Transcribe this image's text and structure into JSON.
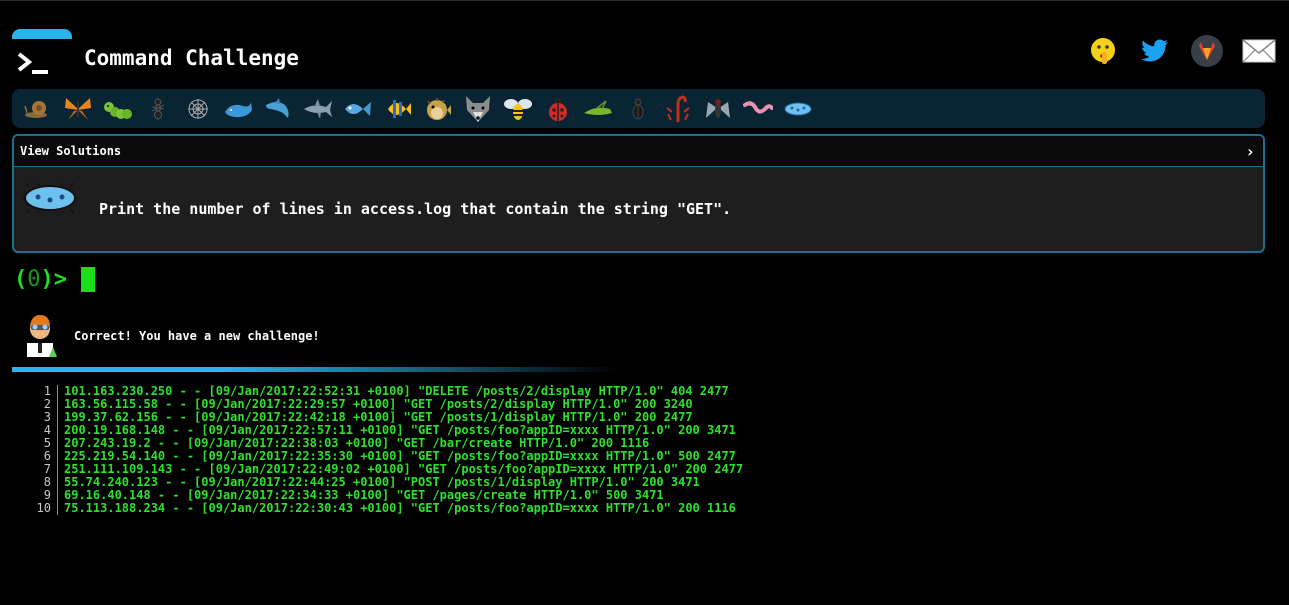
{
  "header": {
    "title": "Command Challenge",
    "logo_icon": "terminal-prompt-icon",
    "social": [
      {
        "name": "shushing-face-icon",
        "label": "emoji"
      },
      {
        "name": "twitter-icon",
        "label": "Twitter"
      },
      {
        "name": "gitlab-icon",
        "label": "GitLab"
      },
      {
        "name": "mail-icon",
        "label": "Email"
      }
    ]
  },
  "levels": [
    {
      "icon": "snail-icon"
    },
    {
      "icon": "butterfly-icon"
    },
    {
      "icon": "caterpillar-icon"
    },
    {
      "icon": "ant-icon"
    },
    {
      "icon": "spider-web-icon"
    },
    {
      "icon": "whale-icon"
    },
    {
      "icon": "dolphin-icon"
    },
    {
      "icon": "shark-icon"
    },
    {
      "icon": "fish-icon"
    },
    {
      "icon": "tropical-fish-icon"
    },
    {
      "icon": "blowfish-icon"
    },
    {
      "icon": "wolf-icon"
    },
    {
      "icon": "bee-icon"
    },
    {
      "icon": "ladybug-icon"
    },
    {
      "icon": "cricket-icon"
    },
    {
      "icon": "beetle-icon"
    },
    {
      "icon": "scorpion-icon"
    },
    {
      "icon": "fly-icon"
    },
    {
      "icon": "worm-icon"
    },
    {
      "icon": "microbe-icon"
    }
  ],
  "challenge": {
    "view_solutions": "View Solutions",
    "chevron": "›",
    "description": "Print the number of lines in access.log that contain the string \"GET\"."
  },
  "prompt": {
    "open": "(",
    "count": "0",
    "close": ")>"
  },
  "message": {
    "text": "Correct! You have a new challenge!"
  },
  "log": [
    {
      "n": "1",
      "text": "101.163.230.250 - - [09/Jan/2017:22:52:31 +0100] \"DELETE /posts/2/display HTTP/1.0\" 404 2477"
    },
    {
      "n": "2",
      "text": "163.56.115.58 - - [09/Jan/2017:22:29:57 +0100] \"GET /posts/2/display HTTP/1.0\" 200 3240"
    },
    {
      "n": "3",
      "text": "199.37.62.156 - - [09/Jan/2017:22:42:18 +0100] \"GET /posts/1/display HTTP/1.0\" 200 2477"
    },
    {
      "n": "4",
      "text": "200.19.168.148 - - [09/Jan/2017:22:57:11 +0100] \"GET /posts/foo?appID=xxxx HTTP/1.0\" 200 3471"
    },
    {
      "n": "5",
      "text": "207.243.19.2 - - [09/Jan/2017:22:38:03 +0100] \"GET /bar/create HTTP/1.0\" 200 1116"
    },
    {
      "n": "6",
      "text": "225.219.54.140 - - [09/Jan/2017:22:35:30 +0100] \"GET /posts/foo?appID=xxxx HTTP/1.0\" 500 2477"
    },
    {
      "n": "7",
      "text": "251.111.109.143 - - [09/Jan/2017:22:49:02 +0100] \"GET /posts/foo?appID=xxxx HTTP/1.0\" 200 2477"
    },
    {
      "n": "8",
      "text": "55.74.240.123 - - [09/Jan/2017:22:44:25 +0100] \"POST /posts/1/display HTTP/1.0\" 200 3471"
    },
    {
      "n": "9",
      "text": "69.16.40.148 - - [09/Jan/2017:22:34:33 +0100] \"GET /pages/create HTTP/1.0\" 500 3471"
    },
    {
      "n": "10",
      "text": "75.113.188.234 - - [09/Jan/2017:22:30:43 +0100] \"GET /posts/foo?appID=xxxx HTTP/1.0\" 200 1116"
    }
  ],
  "colors": {
    "accent": "#2ab3e8",
    "prompt_green": "#1ee01e",
    "log_green": "#2de02d",
    "level_bar_bg": "#092433",
    "challenge_border": "#1d6f8f"
  }
}
